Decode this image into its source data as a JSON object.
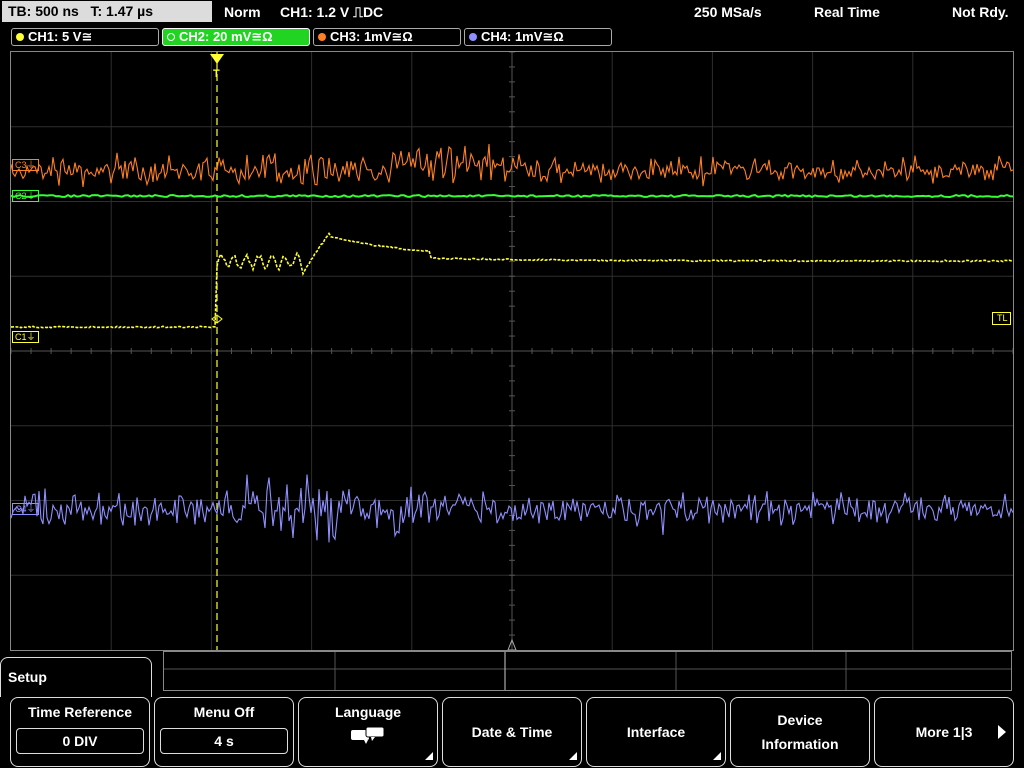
{
  "status_bar": {
    "timebase": "TB: 500 ns",
    "trigger_time": "T: 1.47 µs",
    "mode": "Norm",
    "trigger": "CH1: 1.2 V ⎍DC",
    "sample_rate": "250 MSa/s",
    "acq_mode": "Real Time",
    "state": "Not Rdy."
  },
  "channels": [
    {
      "label": "CH1: 5 V≅",
      "color": "#ffff33"
    },
    {
      "label": "CH2: 20 mV≅Ω",
      "color": "#33ff33"
    },
    {
      "label": "CH3: 1mV≅Ω",
      "color": "#ff7f24"
    },
    {
      "label": "CH4: 1mV≅Ω",
      "color": "#8f8fff"
    }
  ],
  "markers": {
    "c1": "C1⏚",
    "c2": "C2⏚",
    "c3": "C3⏚",
    "c4": "C4⏚",
    "trigger_level": "TL",
    "trigger_point": "T"
  },
  "menu": {
    "title": "Setup",
    "softkeys": [
      {
        "label": "Time Reference",
        "value": "0 DIV"
      },
      {
        "label": "Menu Off",
        "value": "4 s"
      },
      {
        "label": "Language",
        "icon": "speech-bubbles-icon"
      },
      {
        "label": "Date & Time"
      },
      {
        "label": "Interface"
      },
      {
        "label1": "Device",
        "label2": "Information"
      },
      {
        "label": "More 1|3",
        "icon": "arrow-right-icon"
      }
    ]
  }
}
